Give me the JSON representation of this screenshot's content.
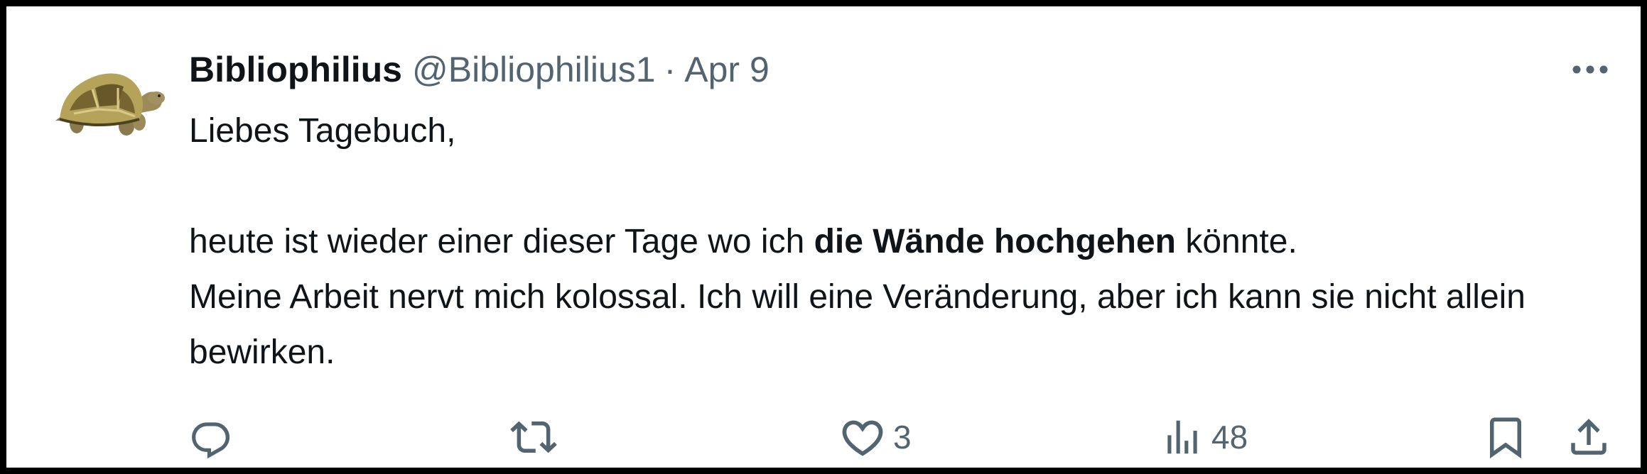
{
  "tweet": {
    "display_name": "Bibliophilius",
    "handle": "@Bibliophilius1",
    "separator": "·",
    "date": "Apr 9",
    "avatar_icon": "tortoise-avatar",
    "body": {
      "greeting": "Liebes Tagebuch,",
      "line1_before": "heute ist wieder einer dieser Tage wo ich ",
      "line1_bold": "die Wände hochgehen",
      "line1_after": " könnte.",
      "line2": "Meine Arbeit nervt mich kolossal. Ich will eine Veränderung, aber ich kann sie nicht allein bewirken."
    }
  },
  "actions": {
    "reply": {
      "icon": "reply-icon"
    },
    "retweet": {
      "icon": "retweet-icon"
    },
    "like": {
      "icon": "heart-icon",
      "count": "3"
    },
    "views": {
      "icon": "views-icon",
      "count": "48"
    },
    "bookmark": {
      "icon": "bookmark-icon"
    },
    "share": {
      "icon": "share-icon"
    },
    "more": {
      "icon": "more-icon"
    }
  },
  "colors": {
    "text_primary": "#0f1419",
    "text_secondary": "#536471",
    "border": "#000000",
    "background": "#ffffff"
  }
}
